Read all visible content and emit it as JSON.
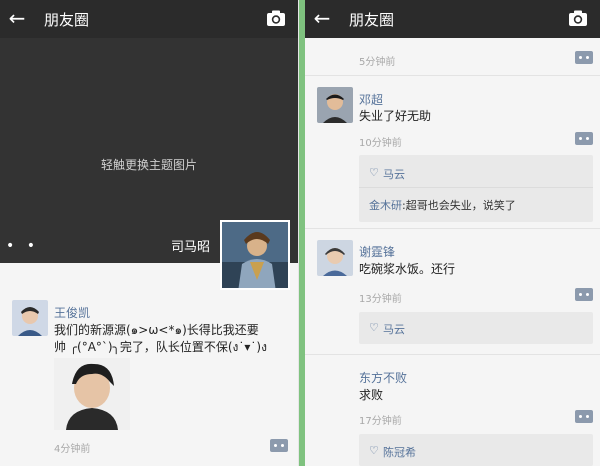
{
  "left": {
    "header": {
      "back_icon": "arrow-left-icon",
      "title": "朋友圈",
      "camera_icon": "camera-icon"
    },
    "cover": {
      "hint": "轻触更换主题图片",
      "dots": "• •",
      "owner_name": "司马昭"
    },
    "post": {
      "author": "王俊凯",
      "text_line1": "我们的新源源(๑>ω<*๑)长得比我还要",
      "text_line2": "帅 ╭(°A°`)╮完了，队长位置不保(ง˙▾˙)ง",
      "time": "4分钟前"
    }
  },
  "right": {
    "header": {
      "back_icon": "arrow-left-icon",
      "title": "朋友圈",
      "camera_icon": "camera-icon"
    },
    "top_time": "5分钟前",
    "posts": [
      {
        "author": "邓超",
        "text": "失业了好无助",
        "time": "10分钟前",
        "liker": "马云",
        "comment_name": "金木研",
        "comment_text": ":超哥也会失业，说笑了"
      },
      {
        "author": "谢霆锋",
        "text": "吃碗浆水饭。还行",
        "time": "13分钟前",
        "liker": "马云"
      },
      {
        "author": "东方不败",
        "text": "求败",
        "time": "17分钟前",
        "liker": "陈冠希"
      }
    ]
  }
}
